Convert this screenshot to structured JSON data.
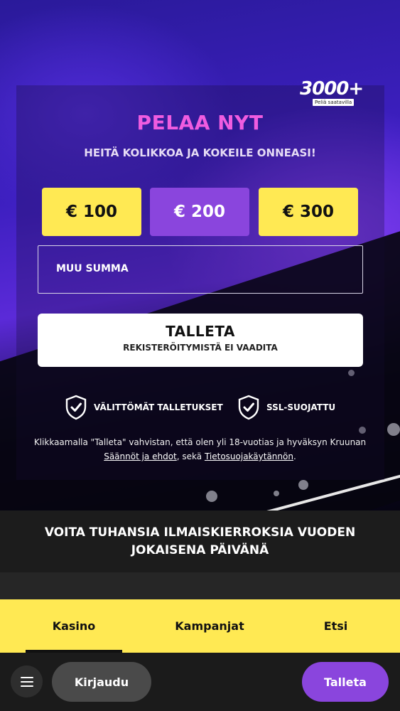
{
  "hero": {
    "badge_number": "3000+",
    "badge_caption": "Peliä saatavilla",
    "title": "PELAA NYT",
    "subtitle": "HEITÄ KOLIKKOA JA KOKEILE ONNEASI!",
    "amounts": [
      "€ 100",
      "€ 200",
      "€ 300"
    ],
    "selected_amount": "€ 200",
    "custom_amount_label": "MUU SUMMA",
    "deposit_button": {
      "label": "TALLETA",
      "sublabel": "REKISTERÖITYMISTÄ EI VAADITA"
    },
    "features": [
      {
        "icon": "shield-check-icon",
        "label": "VÄLITTÖMÄT TALLETUKSET"
      },
      {
        "icon": "shield-check-icon",
        "label": "SSL-SUOJATTU"
      }
    ],
    "legal": {
      "text_1": "Klikkaamalla \"Talleta\" vahvistan, että olen yli 18-vuotias ja hyväksyn Kruunan ",
      "link_terms": "Säännöt ja ehdot",
      "text_2": ", sekä ",
      "link_privacy": "Tietosuojakäytännön",
      "text_3": "."
    }
  },
  "promo": {
    "text": "VOITA TUHANSIA ILMAISKIERROKSIA VUODEN JOKAISENA PÄIVÄNÄ"
  },
  "tabs": [
    {
      "label": "Kasino",
      "active": true
    },
    {
      "label": "Kampanjat",
      "active": false
    },
    {
      "label": "Etsi",
      "active": false
    }
  ],
  "bottom_bar": {
    "menu_icon": "hamburger-menu-icon",
    "login_label": "Kirjaudu",
    "deposit_label": "Talleta"
  },
  "colors": {
    "accent_yellow": "#ffe953",
    "accent_purple": "#8a45dd",
    "title_pink": "#f05ce0"
  }
}
